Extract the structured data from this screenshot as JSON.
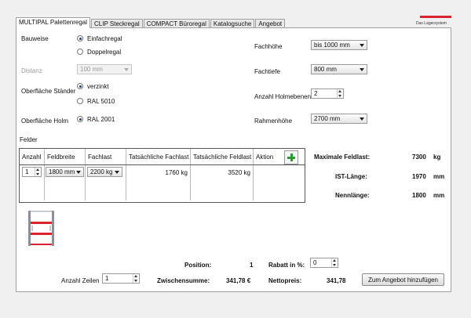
{
  "tabs": [
    "MULTIPAL Palettenregal",
    "CLIP Steckregal",
    "COMPACT Büroregal",
    "Katalogsuche",
    "Angebot"
  ],
  "logo": {
    "text": "Das Lagersystem",
    "color": "#d9232e"
  },
  "left": {
    "bauweise_label": "Bauweise",
    "bauweise_options": [
      "Einfachregal",
      "Doppelregal"
    ],
    "distanz_label": "Distanz",
    "distanz_value": "100 mm",
    "oberflaeche_staender_label": "Oberfläche Ständer",
    "staender_options": [
      "verzinkt",
      "RAL 5010"
    ],
    "oberflaeche_holm_label": "Oberfläche Holm",
    "holm_option": "RAL 2001"
  },
  "right": {
    "fachhoehe_label": "Fachhöhe",
    "fachhoehe_value": "bis 1000 mm",
    "fachtiefe_label": "Fachtiefe",
    "fachtiefe_value": "800 mm",
    "holmebenen_label": "Anzahl Holmebenen",
    "holmebenen_value": "2",
    "rahmenhoehe_label": "Rahmenhöhe",
    "rahmenhoehe_value": "2700 mm"
  },
  "felder": {
    "label": "Felder",
    "headers": [
      "Anzahl",
      "Feldbreite",
      "Fachlast",
      "Tatsächliche Fachlast",
      "Tatsächliche Feldlast",
      "Aktion"
    ],
    "row": {
      "anzahl": "1",
      "feldbreite": "1800 mm",
      "fachlast": "2200 kg",
      "tats_fachlast": "1760 kg",
      "tats_feldlast": "3520 kg"
    }
  },
  "stats": {
    "max_feldlast_label": "Maximale Feldlast:",
    "max_feldlast_value": "7300",
    "max_feldlast_unit": "kg",
    "ist_laenge_label": "IST-Länge:",
    "ist_laenge_value": "1970",
    "ist_laenge_unit": "mm",
    "nennlaenge_label": "Nennlänge:",
    "nennlaenge_value": "1800",
    "nennlaenge_unit": "mm"
  },
  "footer": {
    "position_label": "Position:",
    "position_value": "1",
    "rabatt_label": "Rabatt in %:",
    "rabatt_value": "0",
    "anzahl_zeilen_label": "Anzahl Zeilen",
    "anzahl_zeilen_value": "1",
    "zwischensumme_label": "Zwischensumme:",
    "zwischensumme_value": "341,78 €",
    "nettopreis_label": "Nettopreis:",
    "nettopreis_value": "341,78",
    "add_button_label": "Zum Angebot hinzufügen"
  }
}
